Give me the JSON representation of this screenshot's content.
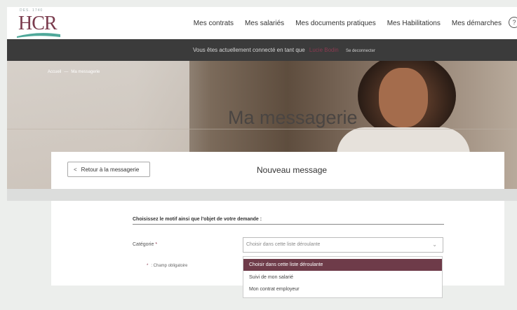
{
  "header": {
    "logo_small": "DES. 1740",
    "logo_text": "HCR",
    "nav": [
      "Mes contrats",
      "Mes salariés",
      "Mes documents pratiques",
      "Mes Habilitations",
      "Mes démarches"
    ],
    "help_glyph": "?"
  },
  "connbar": {
    "prefix": "Vous êtes actuellement connecté en tant que",
    "name": "Lucie Bodin",
    "logout": "Se deconnecter"
  },
  "hero": {
    "breadcrumb_home": "Accueil",
    "breadcrumb_current": "Ma messagerie",
    "title": "Ma messagerie"
  },
  "card": {
    "back_label": "Retour à la messagerie",
    "title": "Nouveau message"
  },
  "form": {
    "heading": "Choisissez le motif ainsi que l'objet de votre demande :",
    "category_label": "Catégorie",
    "required_mark": "*",
    "select_placeholder": "Choisir dans cette liste déroulante",
    "required_note": ": Champ obligatoire",
    "options": [
      "Choisir dans cette liste déroulante",
      "Suivi de mon salarié",
      "Mon contrat employeur"
    ]
  },
  "colors": {
    "brand": "#7a3b4d",
    "accent": "#6e3b49",
    "teal": "#4fa89a"
  }
}
